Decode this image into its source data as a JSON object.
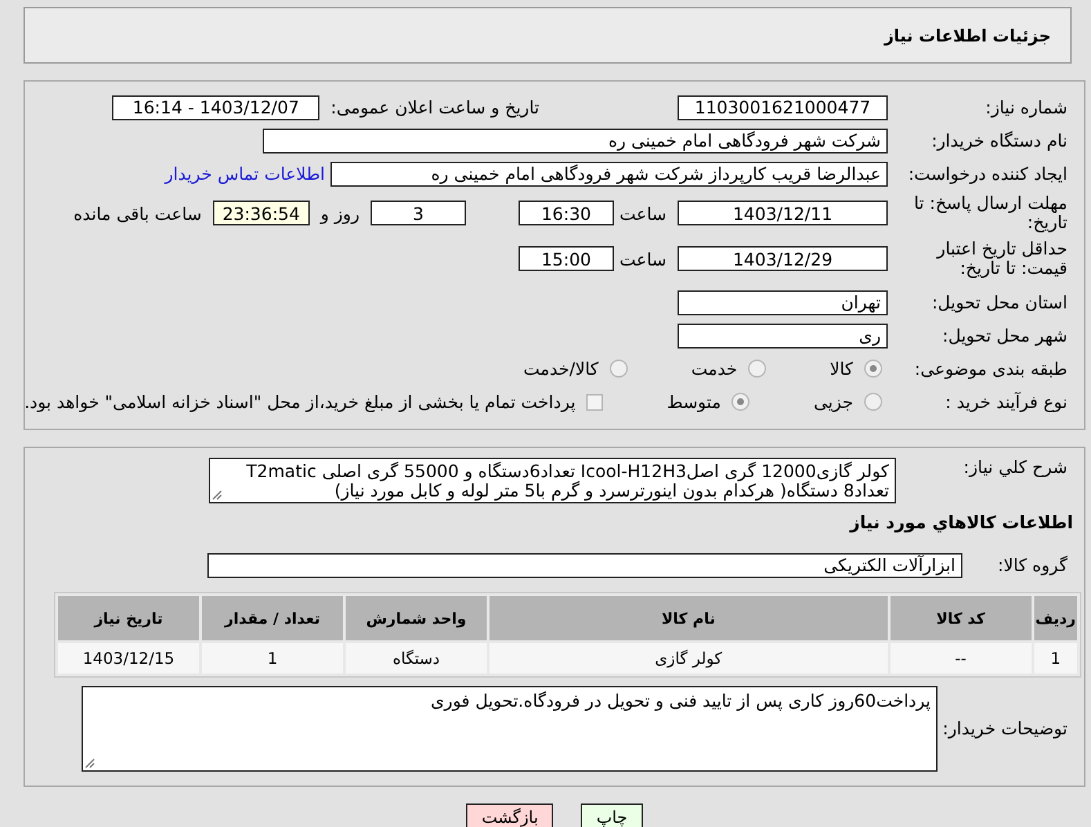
{
  "header": {
    "title": "جزئیات اطلاعات نیاز"
  },
  "need_number": {
    "label": "شماره نیاز:",
    "value": "1103001621000477"
  },
  "announce": {
    "label": "تاریخ و ساعت اعلان عمومی:",
    "value": "1403/12/07 - 16:14"
  },
  "buyer": {
    "label": "نام دستگاه خریدار:",
    "value": "شرکت شهر فرودگاهی امام خمینی  ره"
  },
  "requester": {
    "label": "ایجاد کننده درخواست:",
    "value": "عبدالرضا قریب کارپرداز شرکت شهر فرودگاهی امام خمینی  ره",
    "link": "اطلاعات تماس خریدار"
  },
  "deadline": {
    "label": "مهلت ارسال پاسخ: تا تاریخ:",
    "date": "1403/12/11",
    "time_label": "ساعت",
    "time": "16:30",
    "days": "3",
    "days_label": "روز و",
    "remaining": "23:36:54",
    "remaining_label": "ساعت باقی مانده"
  },
  "validity": {
    "label": "حداقل تاریخ اعتبار قیمت: تا تاریخ:",
    "date": "1403/12/29",
    "time_label": "ساعت",
    "time": "15:00"
  },
  "province": {
    "label": "استان محل تحویل:",
    "value": "تهران"
  },
  "city": {
    "label": "شهر محل تحویل:",
    "value": "ری"
  },
  "category": {
    "label": "طبقه بندی موضوعی:",
    "options": [
      {
        "label": "کالا",
        "selected": true
      },
      {
        "label": "خدمت",
        "selected": false
      },
      {
        "label": "کالا/خدمت",
        "selected": false
      }
    ]
  },
  "process": {
    "label": "نوع فرآیند خرید :",
    "options": [
      {
        "label": "جزیی",
        "selected": false
      },
      {
        "label": "متوسط",
        "selected": true
      }
    ],
    "treasury": {
      "label": "پرداخت تمام یا بخشی از مبلغ خرید،از محل \"اسناد خزانه اسلامی\" خواهد بود.",
      "checked": false
    }
  },
  "description": {
    "label": "شرح کلي نیاز:",
    "value": "کولر گازی12000 گری اصلIcool-H12H3 تعداد6دستگاه و 55000 گری اصلی T2matic تعداد8 دستگاه( هرکدام بدون اینورترسرد و گرم با5 متر لوله و کابل مورد نیاز)"
  },
  "goods_title": "اطلاعات کالاهاي مورد نیاز",
  "goods_group": {
    "label": "گروه کالا:",
    "value": "ابزارآلات الکتریکی"
  },
  "table": {
    "columns": [
      "ردیف",
      "کد کالا",
      "نام کالا",
      "واحد شمارش",
      "تعداد / مقدار",
      "تاریخ نیاز"
    ],
    "rows": [
      [
        "1",
        "--",
        "کولر گازی",
        "دستگاه",
        "1",
        "1403/12/15"
      ]
    ]
  },
  "buyer_notes": {
    "label": "توضیحات خریدار:",
    "value": "پرداخت60روز کاری پس از تایید فنی و تحویل در فرودگاه.تحویل فوری"
  },
  "buttons": [
    {
      "label": "چاپ",
      "kind": "print"
    },
    {
      "label": "بازگشت",
      "kind": "back"
    }
  ]
}
